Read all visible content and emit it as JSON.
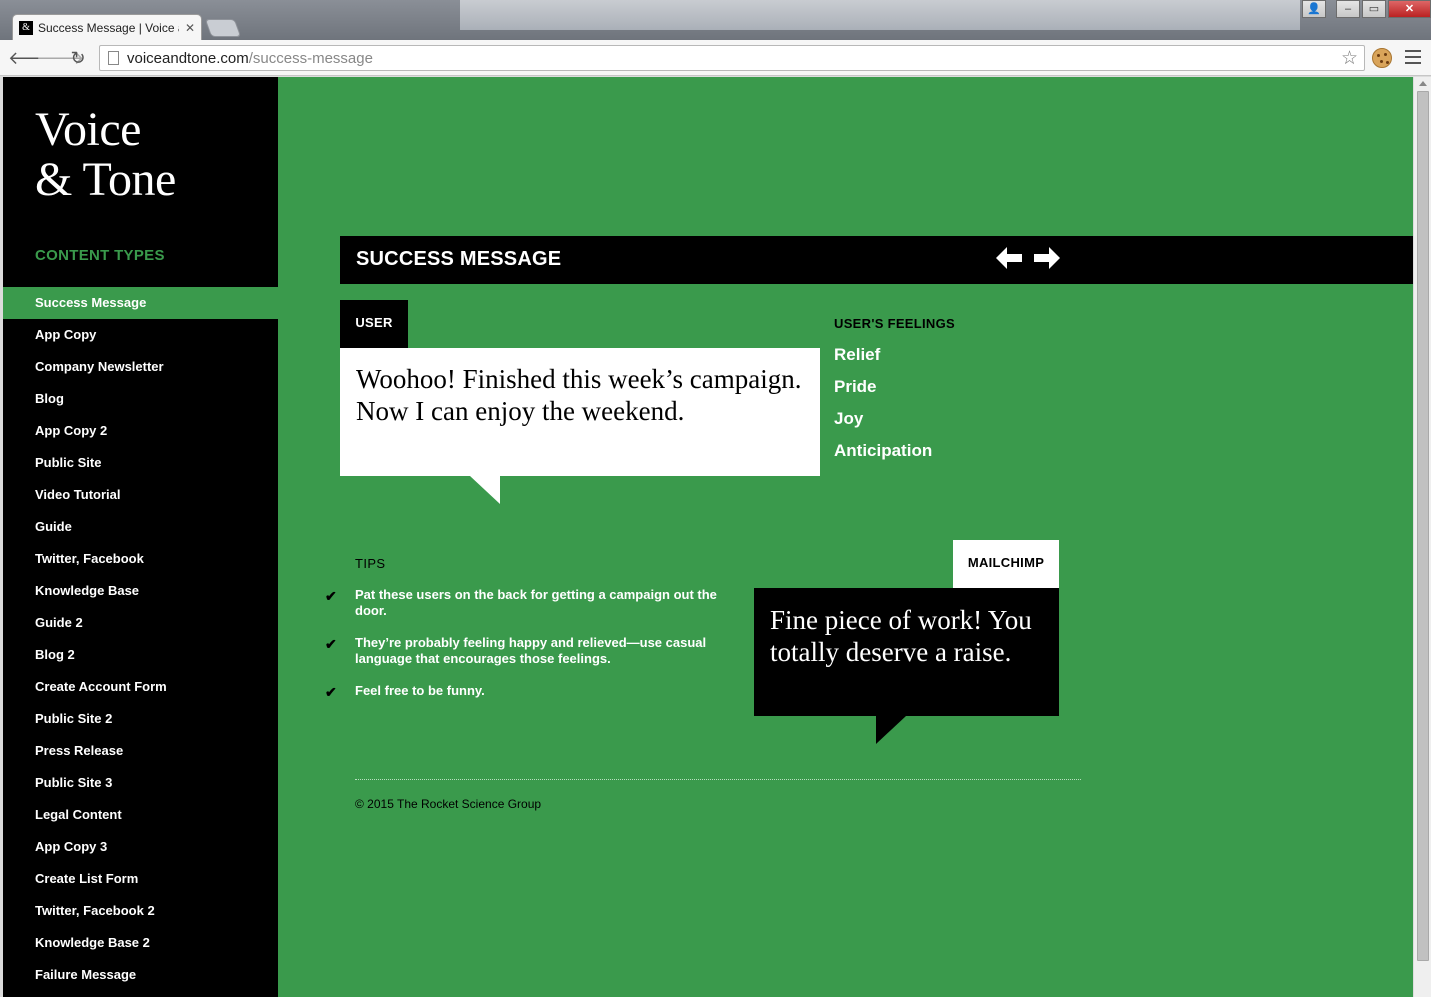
{
  "browser": {
    "tab_title": "Success Message | Voice and Tone",
    "tab_favicon": "&",
    "url_domain": "voiceandtone.com",
    "url_path": "/success-message"
  },
  "logo": {
    "line1": "Voice",
    "line2": "& Tone"
  },
  "sidebar": {
    "heading": "CONTENT TYPES",
    "items": [
      "Success Message",
      "App Copy",
      "Company Newsletter",
      "Blog",
      "App Copy 2",
      "Public Site",
      "Video Tutorial",
      "Guide",
      "Twitter, Facebook",
      "Knowledge Base",
      "Guide 2",
      "Blog 2",
      "Create Account Form",
      "Public Site 2",
      "Press Release",
      "Public Site 3",
      "Legal Content",
      "App Copy 3",
      "Create List Form",
      "Twitter, Facebook 2",
      "Knowledge Base 2",
      "Failure Message"
    ],
    "active_index": 0
  },
  "main": {
    "title": "SUCCESS MESSAGE",
    "user_tag": "USER",
    "user_quote": "Woohoo! Finished this week’s campaign. Now I can enjoy the weekend.",
    "feelings_heading": "USER'S FEELINGS",
    "feelings": [
      "Relief",
      "Pride",
      "Joy",
      "Anticipation"
    ],
    "tips_heading": "TIPS",
    "tips": [
      "Pat these users on the back for getting a campaign out the door.",
      "They’re probably feeling happy and relieved—use casual language that encourages those feelings.",
      "Feel free to be funny."
    ],
    "mailchimp_tag": "MAILCHIMP",
    "mailchimp_quote": "Fine piece of work! You totally deserve a raise.",
    "copyright": "© 2015 The Rocket Science Group"
  },
  "colors": {
    "page_green": "#3a9a4c",
    "sidebar_black": "#000000"
  }
}
